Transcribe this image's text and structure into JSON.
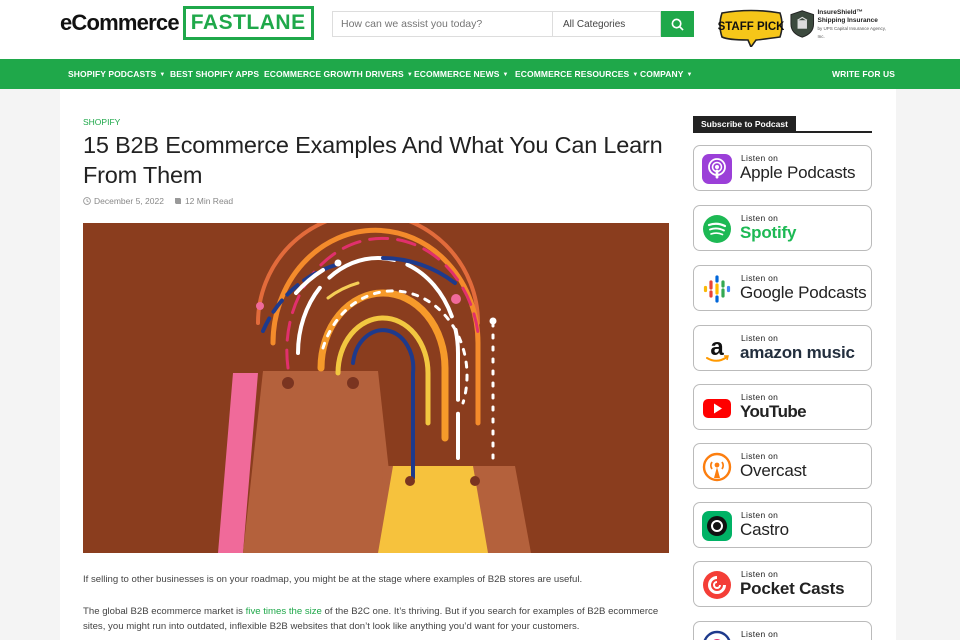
{
  "header": {
    "logo_left": "eCommerce",
    "logo_box": "FASTLANE",
    "search_placeholder": "How can we assist you today?",
    "category_select": "All Categories",
    "staff_pick": "STAFF PICK",
    "insure_line1": "InsureShield™",
    "insure_line2": "Shipping Insurance",
    "insure_small": "by UPS Capital Insurance Agency, Inc."
  },
  "nav": {
    "items": [
      "SHOPIFY PODCASTS",
      "BEST SHOPIFY APPS",
      "ECOMMERCE GROWTH DRIVERS",
      "ECOMMERCE NEWS",
      "ECOMMERCE RESOURCES",
      "COMPANY"
    ],
    "write": "WRITE FOR US"
  },
  "article": {
    "category": "SHOPIFY",
    "title": "15 B2B Ecommerce Examples And What You Can Learn From Them",
    "date": "December 5, 2022",
    "read_time": "12 Min Read",
    "p1": "If selling to other businesses is on your roadmap, you might be at the stage where examples of B2B stores are useful.",
    "p2_before": "The global B2B ecommerce market is ",
    "p2_link": "five times the size",
    "p2_after": " of the B2C one. It’s thriving. But if you search for examples of B2B ecommerce sites, you might run into outdated, inflexible B2B websites that don’t look like anything you’d want for your customers."
  },
  "sidebar": {
    "heading": "Subscribe to Podcast",
    "listen_on": "Listen on",
    "podcasts": [
      {
        "name": "Apple Podcasts",
        "icon": "apple-podcasts-icon"
      },
      {
        "name": "Spotify",
        "icon": "spotify-icon"
      },
      {
        "name": "Google Podcasts",
        "icon": "google-podcasts-icon"
      },
      {
        "name": "amazon music",
        "icon": "amazon-music-icon"
      },
      {
        "name": "YouTube",
        "icon": "youtube-icon"
      },
      {
        "name": "Overcast",
        "icon": "overcast-icon"
      },
      {
        "name": "Castro",
        "icon": "castro-icon"
      },
      {
        "name": "Pocket Casts",
        "icon": "pocket-casts-icon"
      },
      {
        "name": "",
        "icon": "podcast-icon"
      }
    ]
  },
  "colors": {
    "brand_green": "#1fa84a",
    "hero_bg": "#8a3d1e"
  }
}
